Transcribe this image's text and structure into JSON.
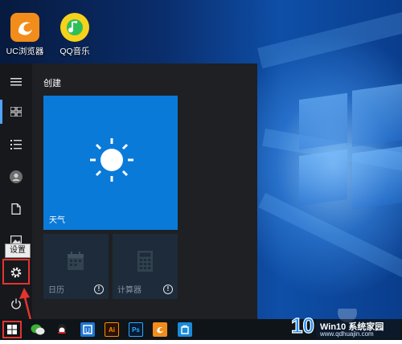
{
  "desktop": {
    "icons": [
      {
        "label": "UC浏览器",
        "icon": "uc-browser-icon",
        "color": "#f28c1b"
      },
      {
        "label": "QQ音乐",
        "icon": "qq-music-icon",
        "color": "#f7d21b"
      }
    ]
  },
  "start_menu": {
    "section_title": "创建",
    "tiles": [
      {
        "name": "天气",
        "icon": "sun-icon",
        "color": "#0a7ad9"
      },
      {
        "name": "日历",
        "icon": "calendar-icon",
        "color": "#1d2b3a"
      },
      {
        "name": "计算器",
        "icon": "calculator-icon",
        "color": "#1d2b3a"
      }
    ],
    "rail": [
      "hamburger-icon",
      "all-apps-icon",
      "list-icon",
      "user-icon",
      "document-icon",
      "pictures-icon",
      "settings-icon",
      "power-icon"
    ],
    "settings_tooltip": "设置",
    "accent": "#4fa3ff"
  },
  "taskbar": {
    "items": [
      "start-button",
      "wechat-icon",
      "qq-icon",
      "browser-icon",
      "illustrator-icon",
      "photoshop-icon",
      "uc-browser-icon",
      "store-icon"
    ]
  },
  "watermark": {
    "brand": "Win10 系统家园",
    "url": "www.qdhuajin.com",
    "badge": "10"
  }
}
